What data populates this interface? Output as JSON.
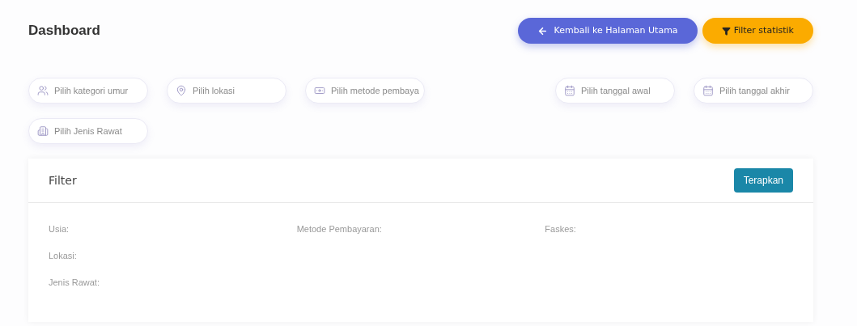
{
  "page_title": "Dashboard",
  "header_buttons": [
    {
      "kind": "back",
      "label": "Kembali ke Halaman Utama"
    },
    {
      "kind": "filter",
      "label": "Filter statistik"
    }
  ],
  "filter_fields_left": [
    {
      "kind": "people",
      "placeholder": "Pilih kategori umur"
    },
    {
      "kind": "location",
      "placeholder": "Pilih lokasi"
    },
    {
      "kind": "money",
      "placeholder": "Pilih metode pembaya"
    }
  ],
  "filter_fields_right": [
    {
      "kind": "calendar",
      "placeholder": "Pilih tanggal awal"
    },
    {
      "kind": "calendar",
      "placeholder": "Pilih tanggal akhir"
    }
  ],
  "filter_fields_second_row": [
    {
      "kind": "building",
      "placeholder": "Pilih Jenis Rawat"
    }
  ],
  "filter_card": {
    "title": "Filter",
    "apply_button": "Terapkan",
    "columns": [
      [
        "Usia:",
        "Lokasi:",
        "Jenis Rawat:"
      ],
      [
        "Metode Pembayaran:"
      ],
      [
        "Faskes:"
      ]
    ]
  }
}
